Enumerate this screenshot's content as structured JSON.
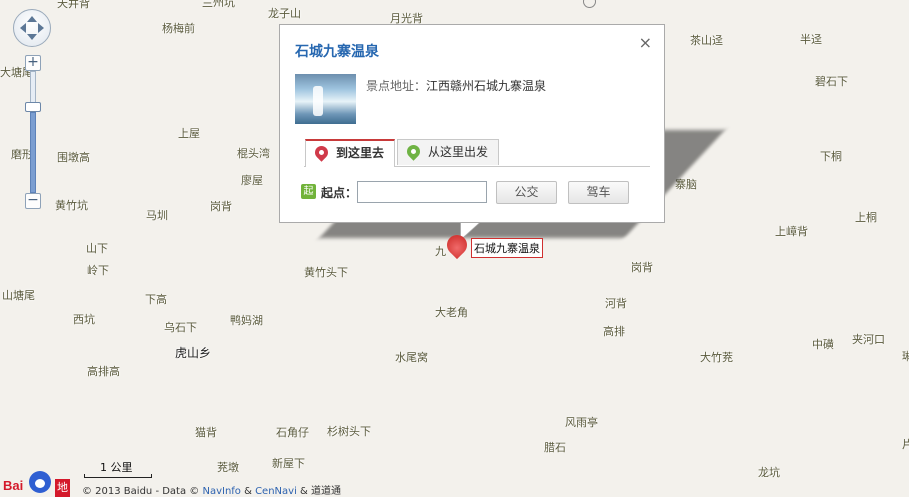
{
  "places": [
    {
      "id": "p1",
      "name": "天井背"
    },
    {
      "id": "p2",
      "name": "兰州坑"
    },
    {
      "id": "p3",
      "name": "龙子山"
    },
    {
      "id": "p4",
      "name": "月光背"
    },
    {
      "id": "p5",
      "name": "杨梅前"
    },
    {
      "id": "p6",
      "name": "大塘尾"
    },
    {
      "id": "p7",
      "name": "上屋"
    },
    {
      "id": "p8",
      "name": "磨形"
    },
    {
      "id": "p9",
      "name": "围墩高"
    },
    {
      "id": "p10",
      "name": "棍头湾"
    },
    {
      "id": "p11",
      "name": "廖屋"
    },
    {
      "id": "p12",
      "name": "黄竹坑"
    },
    {
      "id": "p13",
      "name": "马圳"
    },
    {
      "id": "p14",
      "name": "岗背"
    },
    {
      "id": "p15",
      "name": "山下"
    },
    {
      "id": "p16",
      "name": "岭下"
    },
    {
      "id": "p17",
      "name": "黄竹头下"
    },
    {
      "id": "p18",
      "name": "山塘尾"
    },
    {
      "id": "p19",
      "name": "下高"
    },
    {
      "id": "p20",
      "name": "西坑"
    },
    {
      "id": "p21",
      "name": "乌石下"
    },
    {
      "id": "p22",
      "name": "鸭妈湖"
    },
    {
      "id": "p23",
      "name": "虎山乡"
    },
    {
      "id": "p24",
      "name": "大老角"
    },
    {
      "id": "p25",
      "name": "高排高"
    },
    {
      "id": "p26",
      "name": "水尾窝"
    },
    {
      "id": "p27",
      "name": "茶山迳"
    },
    {
      "id": "p28",
      "name": "半迳"
    },
    {
      "id": "p29",
      "name": "碧石下"
    },
    {
      "id": "p30",
      "name": "下桐"
    },
    {
      "id": "p31",
      "name": "寨脑"
    },
    {
      "id": "p32",
      "name": "上桐"
    },
    {
      "id": "p33",
      "name": "上嶂背"
    },
    {
      "id": "p34",
      "name": "岗背"
    },
    {
      "id": "p35",
      "name": "河背"
    },
    {
      "id": "p36",
      "name": "高排"
    },
    {
      "id": "p37",
      "name": "中磺"
    },
    {
      "id": "p38",
      "name": "夹河口"
    },
    {
      "id": "p39",
      "name": "大竹茺"
    },
    {
      "id": "p40",
      "name": "风雨亭"
    },
    {
      "id": "p41",
      "name": "腊石"
    },
    {
      "id": "p42",
      "name": "猫背"
    },
    {
      "id": "p43",
      "name": "石角仔"
    },
    {
      "id": "p44",
      "name": "杉树头下"
    },
    {
      "id": "p45",
      "name": "茺墩"
    },
    {
      "id": "p46",
      "name": "新屋下"
    },
    {
      "id": "p47",
      "name": "龙坑"
    },
    {
      "id": "p48",
      "name": "九"
    },
    {
      "id": "p49",
      "name": "琳"
    },
    {
      "id": "p50",
      "name": "片"
    }
  ],
  "popup": {
    "title": "石城九寨温泉",
    "close_symbol": "×",
    "address_label": "景点地址：",
    "address_value": "江西赣州石城九寨温泉",
    "tabs": [
      {
        "label": "到这里去"
      },
      {
        "label": "从这里出发"
      }
    ],
    "start_badge": "起",
    "start_label": "起点：",
    "start_value": "",
    "start_placeholder": "",
    "btn_bus": "公交",
    "btn_drive": "驾车"
  },
  "marker": {
    "label": "石城九寨温泉"
  },
  "zoom": {
    "plus": "+",
    "minus": "−",
    "level_fraction": 0.66
  },
  "scale": {
    "label": "1 公里"
  },
  "logo": {
    "bai": "Bai",
    "tu": "地图"
  },
  "copyright": {
    "prefix": "© 2013 Baidu - Data © ",
    "navinfo": "NavInfo",
    "amp1": " & ",
    "cennavi": "CenNavi",
    "amp2": " & ",
    "daodao": "道道通"
  },
  "colors": {
    "accent": "#2667b0",
    "marker": "#c8231f",
    "go_tab": "#c83a3a",
    "start_badge": "#71b33a"
  }
}
